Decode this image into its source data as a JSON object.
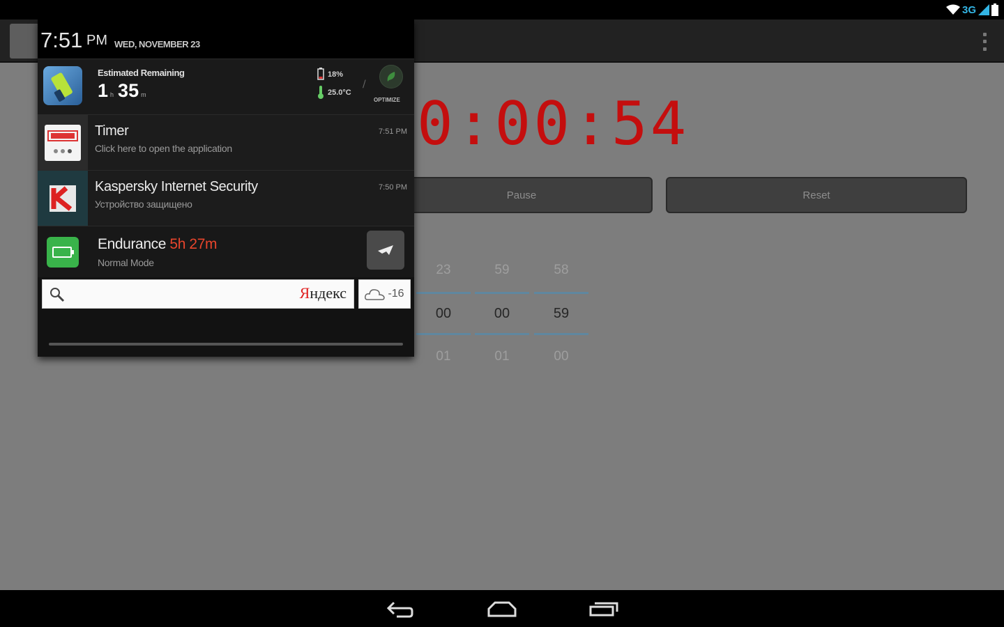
{
  "status_bar": {
    "network": "3G"
  },
  "timer": {
    "display": "0:00:54",
    "pause_label": "Pause",
    "reset_label": "Reset",
    "picker": {
      "hours": {
        "prev": "23",
        "current": "00",
        "next": "01"
      },
      "minutes": {
        "prev": "59",
        "current": "00",
        "next": "01"
      },
      "seconds": {
        "prev": "58",
        "current": "59",
        "next": "00"
      }
    },
    "accent_color": "#c40e0e"
  },
  "shade": {
    "time": "7:51",
    "ampm": "PM",
    "date": "WED, NOVEMBER 23",
    "battery_widget": {
      "label": "Estimated Remaining",
      "hours": "1",
      "hours_unit": "h",
      "minutes": "35",
      "minutes_unit": "m",
      "percent": "18%",
      "temperature": "25.0°C",
      "optimize_label": "OPTIMIZE"
    },
    "notifications": [
      {
        "title": "Timer",
        "subtitle": "Click here to open the application",
        "time": "7:51 PM",
        "icon": "timer-icon"
      },
      {
        "title": "Kaspersky Internet Security",
        "subtitle": "Устройство защищено",
        "time": "7:50 PM",
        "icon": "kaspersky-icon"
      },
      {
        "title": "Endurance",
        "highlight": "5h 27m",
        "subtitle": "Normal Mode",
        "icon": "battery-icon"
      }
    ],
    "search": {
      "brand_first": "Я",
      "brand_rest": "ндекс",
      "placeholder": ""
    },
    "weather": {
      "temp": "-16",
      "icon": "cloud-icon"
    }
  }
}
